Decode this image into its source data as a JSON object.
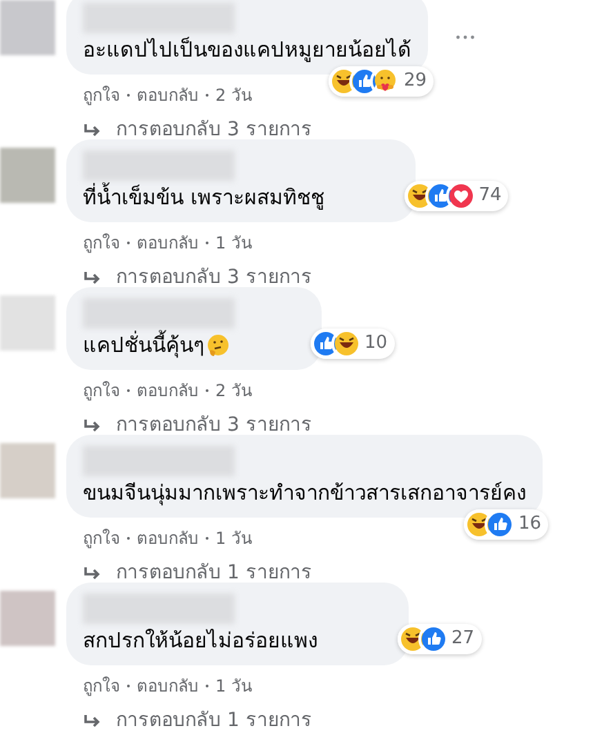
{
  "comments": [
    {
      "color": "#c8c8cc",
      "text": "อะแดปไปเป็นของแคปหมูยายน้อยได้",
      "more_button": true,
      "reactions_below": true,
      "reactions": [
        {
          "kind": "haha"
        },
        {
          "kind": "like"
        },
        {
          "kind": "care"
        }
      ],
      "reaction_count": "29",
      "like_label": "ถูกใจ",
      "reply_label": "ตอบกลับ",
      "time": "2 วัน",
      "replies_link": "การตอบกลับ 3 รายการ"
    },
    {
      "color": "#b9b9b2",
      "text": "ที่น้ำเข็มข้น เพราะผสมทิชชู",
      "more_button": false,
      "reactions_below": false,
      "reactions": [
        {
          "kind": "haha"
        },
        {
          "kind": "like"
        },
        {
          "kind": "love"
        }
      ],
      "reaction_count": "74",
      "like_label": "ถูกใจ",
      "reply_label": "ตอบกลับ",
      "time": "1 วัน",
      "replies_link": "การตอบกลับ 3 รายการ"
    },
    {
      "color": "#e2e2e2",
      "text": "แคปชั่นนี้คุ้นๆ",
      "trailing_emoji": {
        "kind": "thinking"
      },
      "more_button": false,
      "reactions_below": false,
      "reactions": [
        {
          "kind": "like"
        },
        {
          "kind": "haha"
        }
      ],
      "reaction_count": "10",
      "like_label": "ถูกใจ",
      "reply_label": "ตอบกลับ",
      "time": "2 วัน",
      "replies_link": "การตอบกลับ 3 รายการ"
    },
    {
      "color": "#d6cfc8",
      "text": "ขนมจีนนุ่มมากเพราะทำจากข้าวสารเสกอาจารย์คง",
      "more_button": false,
      "reactions_below": true,
      "reactions": [
        {
          "kind": "haha"
        },
        {
          "kind": "like"
        }
      ],
      "reaction_count": "16",
      "like_label": "ถูกใจ",
      "reply_label": "ตอบกลับ",
      "time": "1 วัน",
      "replies_link": "การตอบกลับ 1 รายการ"
    },
    {
      "color": "#cfc4c4",
      "text": "สกปรกให้น้อยไม่อร่อยแพง",
      "more_button": false,
      "reactions_below": false,
      "reactions": [
        {
          "kind": "haha"
        },
        {
          "kind": "like"
        }
      ],
      "reaction_count": "27",
      "like_label": "ถูกใจ",
      "reply_label": "ตอบกลับ",
      "time": "1 วัน",
      "replies_link": "การตอบกลับ 1 รายการ"
    }
  ]
}
